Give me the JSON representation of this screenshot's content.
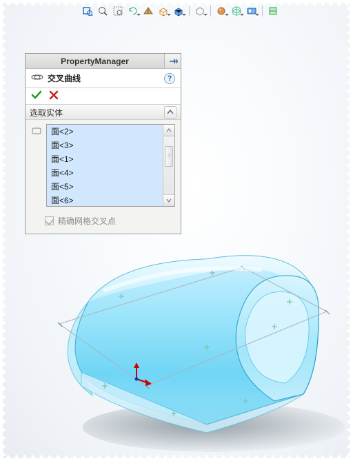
{
  "toolbar": {
    "icons": [
      "zoom-to-fit",
      "zoom-in",
      "zoom-window",
      "prev-view",
      "section-view",
      "view-orientation",
      "display-style",
      "hide-show",
      "cube-view",
      "edit-appearance",
      "apply-scene",
      "view-settings",
      "rebuild-icon"
    ]
  },
  "pm": {
    "titlebar": "PropertyManager",
    "feature_name": "交叉曲线",
    "section_title": "选取实体",
    "items": [
      "面<2>",
      "面<3>",
      "面<1>",
      "面<4>",
      "面<5>",
      "面<6>"
    ],
    "checkbox_label": "精确网格交叉点"
  }
}
